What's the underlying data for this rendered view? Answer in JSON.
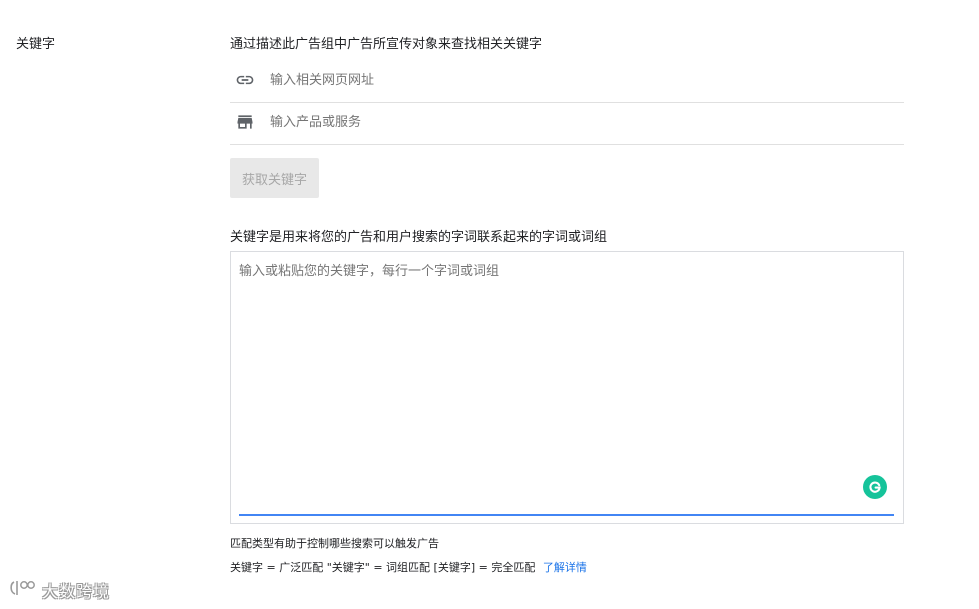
{
  "section": {
    "label": "关键字",
    "description": "通过描述此广告组中广告所宣传对象来查找相关关键字"
  },
  "url_input": {
    "placeholder": "输入相关网页网址",
    "icon": "link-icon"
  },
  "product_input": {
    "placeholder": "输入产品或服务",
    "icon": "store-icon"
  },
  "get_keywords_button": {
    "label": "获取关键字"
  },
  "keywords": {
    "heading": "关键字是用来将您的广告和用户搜索的字词联系起来的字词或词组",
    "placeholder": "输入或粘贴您的关键字，每行一个字词或词组",
    "value": ""
  },
  "help": {
    "line1": "匹配类型有助于控制哪些搜索可以触发广告",
    "line2": "关键字 = 广泛匹配  \"关键字\" = 词组匹配  [关键字] = 完全匹配",
    "learn_more": "了解详情"
  },
  "watermark": {
    "text": "大数跨境"
  },
  "colors": {
    "accent": "#4285f4",
    "link": "#1a73e8",
    "grammarly": "#15c39a",
    "disabled_button_bg": "#e8e8e8",
    "disabled_button_text": "#a7a7a7"
  }
}
